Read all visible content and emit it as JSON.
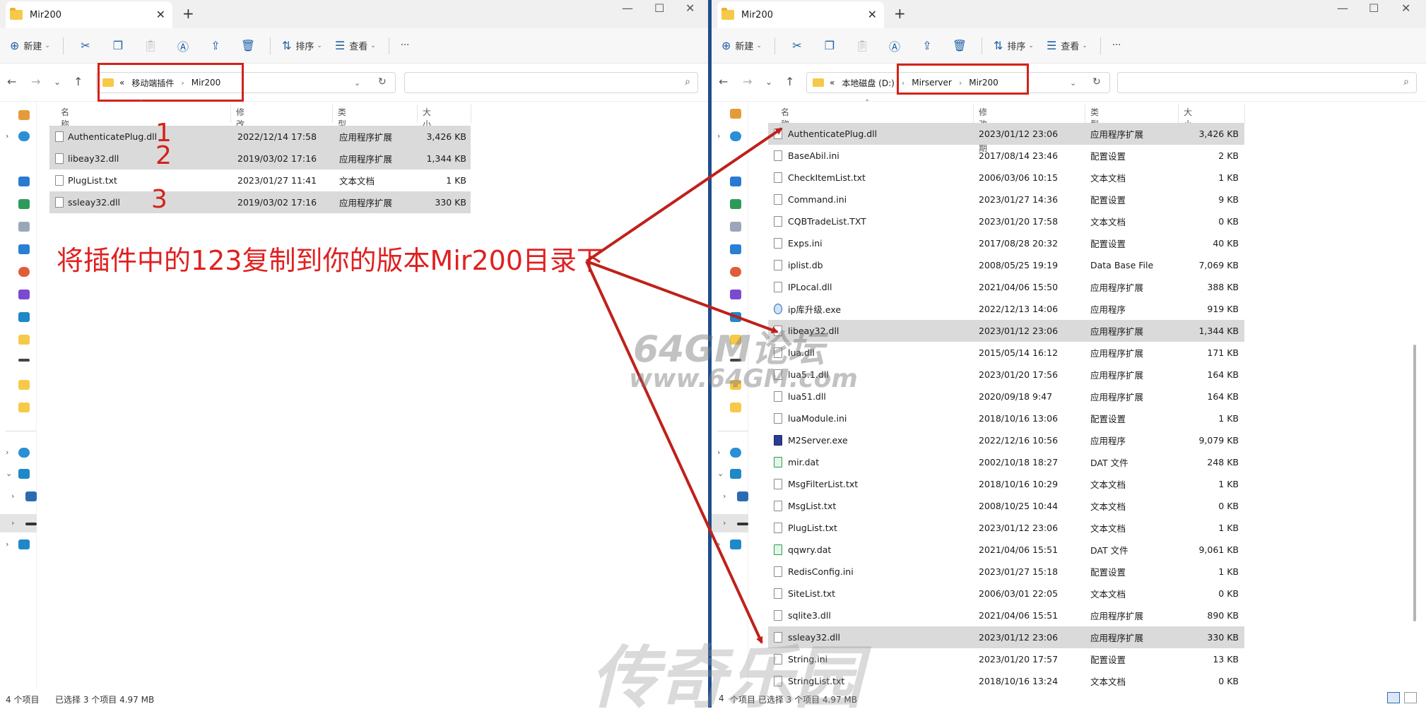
{
  "left": {
    "tab_title": "Mir200",
    "toolbar": {
      "new_label": "新建",
      "sort_label": "排序",
      "view_label": "查看",
      "more_label": "···"
    },
    "address": {
      "prefix": "«",
      "path": [
        "移动端插件",
        "Mir200"
      ]
    },
    "columns": {
      "name": "名称",
      "date": "修改日期",
      "type": "类型",
      "size": "大小"
    },
    "files": [
      {
        "name": "AuthenticatePlug.dll",
        "date": "2022/12/14 17:58",
        "type": "应用程序扩展",
        "size": "3,426 KB",
        "selected": true
      },
      {
        "name": "libeay32.dll",
        "date": "2019/03/02 17:16",
        "type": "应用程序扩展",
        "size": "1,344 KB",
        "selected": true
      },
      {
        "name": "PlugList.txt",
        "date": "2023/01/27 11:41",
        "type": "文本文档",
        "size": "1 KB",
        "selected": false
      },
      {
        "name": "ssleay32.dll",
        "date": "2019/03/02 17:16",
        "type": "应用程序扩展",
        "size": "330 KB",
        "selected": true
      }
    ],
    "status": {
      "count": "4 个项目",
      "selection": "已选择 3 个项目  4.97 MB"
    }
  },
  "right": {
    "tab_title": "Mir200",
    "toolbar": {
      "new_label": "新建",
      "sort_label": "排序",
      "view_label": "查看",
      "more_label": "···"
    },
    "address": {
      "prefix": "«",
      "path": [
        "本地磁盘 (D:)",
        "Mirserver",
        "Mir200"
      ]
    },
    "columns": {
      "name": "名称",
      "date": "修改日期",
      "type": "类型",
      "size": "大小"
    },
    "files": [
      {
        "name": "AuthenticatePlug.dll",
        "date": "2023/01/12 23:06",
        "type": "应用程序扩展",
        "size": "3,426 KB",
        "selected": true,
        "icon": "file"
      },
      {
        "name": "BaseAbil.ini",
        "date": "2017/08/14 23:46",
        "type": "配置设置",
        "size": "2 KB",
        "selected": false,
        "icon": "file"
      },
      {
        "name": "CheckItemList.txt",
        "date": "2006/03/06 10:15",
        "type": "文本文档",
        "size": "1 KB",
        "selected": false,
        "icon": "file"
      },
      {
        "name": "Command.ini",
        "date": "2023/01/27 14:36",
        "type": "配置设置",
        "size": "9 KB",
        "selected": false,
        "icon": "file"
      },
      {
        "name": "CQBTradeList.TXT",
        "date": "2023/01/20 17:58",
        "type": "文本文档",
        "size": "0 KB",
        "selected": false,
        "icon": "file"
      },
      {
        "name": "Exps.ini",
        "date": "2017/08/28 20:32",
        "type": "配置设置",
        "size": "40 KB",
        "selected": false,
        "icon": "file"
      },
      {
        "name": "iplist.db",
        "date": "2008/05/25 19:19",
        "type": "Data Base File",
        "size": "7,069 KB",
        "selected": false,
        "icon": "file"
      },
      {
        "name": "IPLocal.dll",
        "date": "2021/04/06 15:50",
        "type": "应用程序扩展",
        "size": "388 KB",
        "selected": false,
        "icon": "file"
      },
      {
        "name": "ip库升级.exe",
        "date": "2022/12/13 14:06",
        "type": "应用程序",
        "size": "919 KB",
        "selected": false,
        "icon": "exe"
      },
      {
        "name": "libeay32.dll",
        "date": "2023/01/12 23:06",
        "type": "应用程序扩展",
        "size": "1,344 KB",
        "selected": true,
        "icon": "file"
      },
      {
        "name": "lua.dll",
        "date": "2015/05/14 16:12",
        "type": "应用程序扩展",
        "size": "171 KB",
        "selected": false,
        "icon": "file"
      },
      {
        "name": "lua5.1.dll",
        "date": "2023/01/20 17:56",
        "type": "应用程序扩展",
        "size": "164 KB",
        "selected": false,
        "icon": "file"
      },
      {
        "name": "lua51.dll",
        "date": "2020/09/18 9:47",
        "type": "应用程序扩展",
        "size": "164 KB",
        "selected": false,
        "icon": "file"
      },
      {
        "name": "luaModule.ini",
        "date": "2018/10/16 13:06",
        "type": "配置设置",
        "size": "1 KB",
        "selected": false,
        "icon": "file"
      },
      {
        "name": "M2Server.exe",
        "date": "2022/12/16 10:56",
        "type": "应用程序",
        "size": "9,079 KB",
        "selected": false,
        "icon": "shield"
      },
      {
        "name": "mir.dat",
        "date": "2002/10/18 18:27",
        "type": "DAT 文件",
        "size": "248 KB",
        "selected": false,
        "icon": "dat"
      },
      {
        "name": "MsgFilterList.txt",
        "date": "2018/10/16 10:29",
        "type": "文本文档",
        "size": "1 KB",
        "selected": false,
        "icon": "file"
      },
      {
        "name": "MsgList.txt",
        "date": "2008/10/25 10:44",
        "type": "文本文档",
        "size": "0 KB",
        "selected": false,
        "icon": "file"
      },
      {
        "name": "PlugList.txt",
        "date": "2023/01/12 23:06",
        "type": "文本文档",
        "size": "1 KB",
        "selected": false,
        "icon": "file"
      },
      {
        "name": "qqwry.dat",
        "date": "2021/04/06 15:51",
        "type": "DAT 文件",
        "size": "9,061 KB",
        "selected": false,
        "icon": "dat"
      },
      {
        "name": "RedisConfig.ini",
        "date": "2023/01/27 15:18",
        "type": "配置设置",
        "size": "1 KB",
        "selected": false,
        "icon": "file"
      },
      {
        "name": "SiteList.txt",
        "date": "2006/03/01 22:05",
        "type": "文本文档",
        "size": "0 KB",
        "selected": false,
        "icon": "file"
      },
      {
        "name": "sqlite3.dll",
        "date": "2021/04/06 15:51",
        "type": "应用程序扩展",
        "size": "890 KB",
        "selected": false,
        "icon": "file"
      },
      {
        "name": "ssleay32.dll",
        "date": "2023/01/12 23:06",
        "type": "应用程序扩展",
        "size": "330 KB",
        "selected": true,
        "icon": "file"
      },
      {
        "name": "String.ini",
        "date": "2023/01/20 17:57",
        "type": "配置设置",
        "size": "13 KB",
        "selected": false,
        "icon": "file"
      },
      {
        "name": "StringList.txt",
        "date": "2018/10/16 13:24",
        "type": "文本文档",
        "size": "0 KB",
        "selected": false,
        "icon": "file"
      }
    ],
    "status": {
      "count": "4",
      "selection": "个项目  已选择 3 个项目  4.97 MB"
    }
  },
  "annotation": {
    "numbers": [
      "1",
      "2",
      "3"
    ],
    "instruction": "将插件中的123复制到你的版本Mir200目录下",
    "color": "#e02020"
  },
  "watermark": {
    "site": "64GM论坛",
    "url": "www.64GM.com",
    "chars": "传奇乐园"
  }
}
